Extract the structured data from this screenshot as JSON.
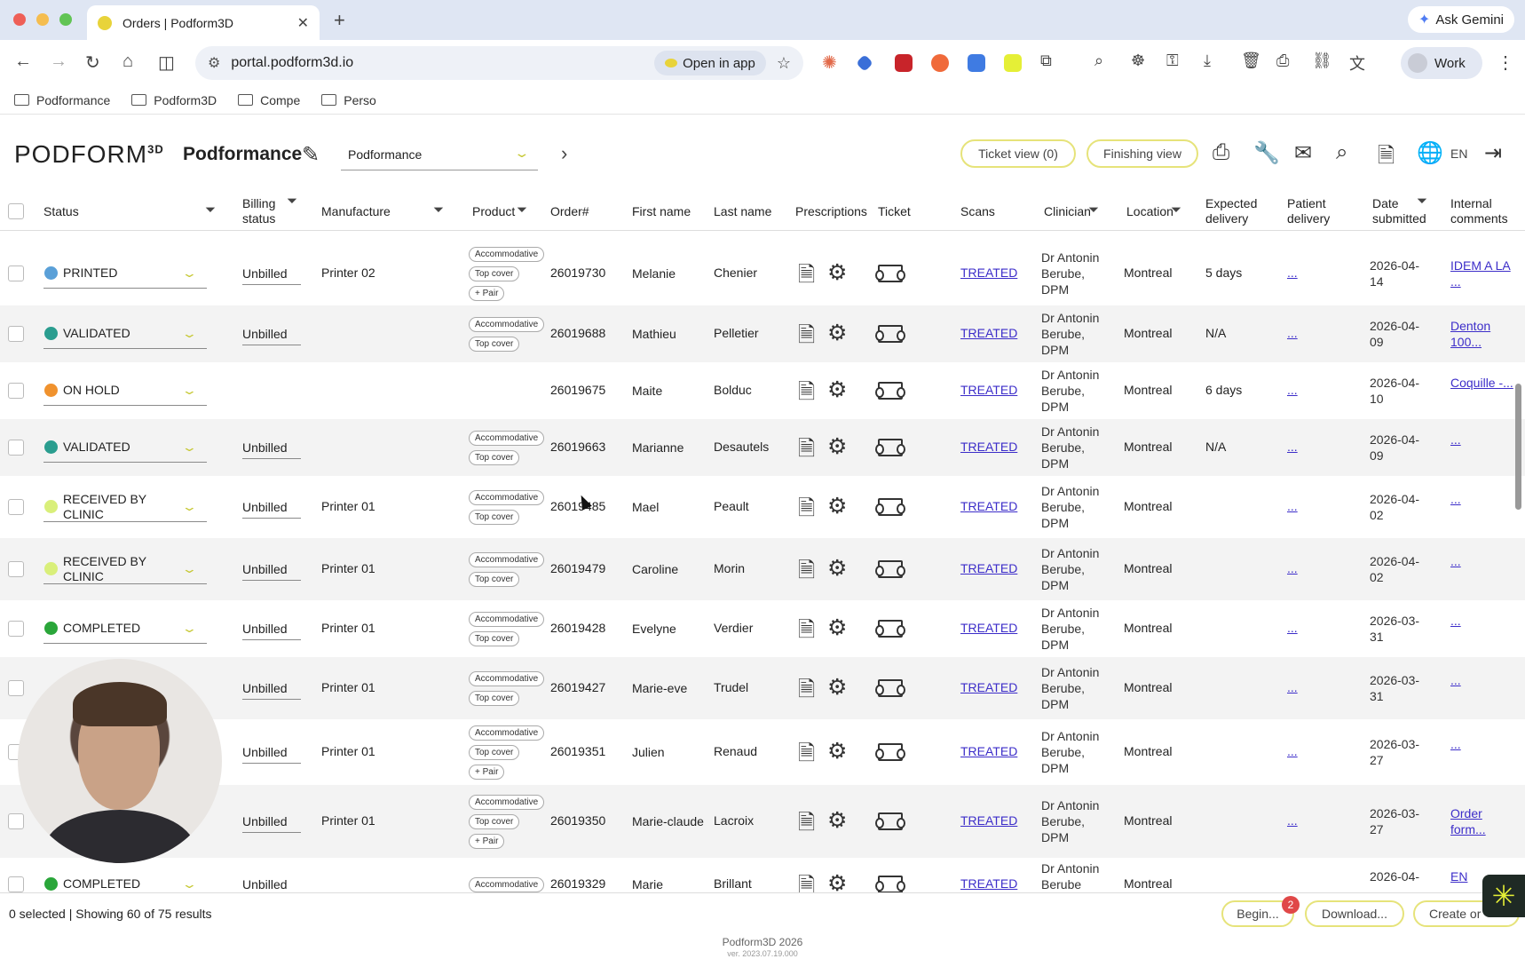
{
  "browser": {
    "tab_title": "Orders | Podform3D",
    "url": "portal.podform3d.io",
    "open_in_app": "Open in app",
    "ask_gemini": "Ask Gemini",
    "profile": "Work",
    "bookmarks": [
      "Podformance",
      "Podform3D",
      "Compe",
      "Perso"
    ],
    "colors": {
      "close": "#ee5f57",
      "minimize": "#f5bd4f",
      "maximize": "#61c454"
    }
  },
  "app": {
    "logo": "PODFORM",
    "logo_sup": "3D",
    "org_title": "Podformance",
    "org_select": "Podformance",
    "ticket_view": "Ticket view (0)",
    "finishing_view": "Finishing view",
    "lang": "EN"
  },
  "columns": {
    "status": "Status",
    "billing": "Billing status",
    "manufacture": "Manufacture",
    "product": "Product",
    "order": "Order#",
    "first": "First name",
    "last": "Last name",
    "prescriptions": "Prescriptions",
    "ticket": "Ticket",
    "scans": "Scans",
    "clinician": "Clinician",
    "location": "Location",
    "expected": "Expected delivery",
    "patient": "Patient delivery",
    "date": "Date submitted",
    "comments": "Internal comments"
  },
  "rows": [
    {
      "status": "PRINTED",
      "dot": "#5aa0d8",
      "billing": "Unbilled",
      "manufacture": "Printer 02",
      "chips": [
        "Accommodative",
        "Top cover",
        "+ Pair"
      ],
      "order": "26019730",
      "first": "Melanie",
      "last": "Chenier",
      "scans": "TREATED",
      "clinician": "Dr Antonin Berube, DPM",
      "location": "Montreal",
      "expected": "5 days",
      "patient": "...",
      "date": "2026-04-14",
      "comment": "IDEM A LA ..."
    },
    {
      "status": "VALIDATED",
      "dot": "#2a9d8f",
      "billing": "Unbilled",
      "manufacture": "",
      "chips": [
        "Accommodative",
        "Top cover"
      ],
      "order": "26019688",
      "first": "Mathieu",
      "last": "Pelletier",
      "scans": "TREATED",
      "clinician": "Dr Antonin Berube, DPM",
      "location": "Montreal",
      "expected": "N/A",
      "patient": "...",
      "date": "2026-04-09",
      "comment": "Denton 100..."
    },
    {
      "status": "ON HOLD",
      "dot": "#f0922e",
      "billing": "",
      "manufacture": "",
      "chips": [],
      "order": "26019675",
      "first": "Maite",
      "last": "Bolduc",
      "scans": "TREATED",
      "clinician": "Dr Antonin Berube, DPM",
      "location": "Montreal",
      "expected": "6 days",
      "patient": "...",
      "date": "2026-04-10",
      "comment": "Coquille -..."
    },
    {
      "status": "VALIDATED",
      "dot": "#2a9d8f",
      "billing": "Unbilled",
      "manufacture": "",
      "chips": [
        "Accommodative",
        "Top cover"
      ],
      "order": "26019663",
      "first": "Marianne",
      "last": "Desautels",
      "scans": "TREATED",
      "clinician": "Dr Antonin Berube, DPM",
      "location": "Montreal",
      "expected": "N/A",
      "patient": "...",
      "date": "2026-04-09",
      "comment": "..."
    },
    {
      "status": "RECEIVED BY CLINIC",
      "dot": "#d9ef7a",
      "billing": "Unbilled",
      "manufacture": "Printer 01",
      "chips": [
        "Accommodative",
        "Top cover"
      ],
      "order": "26019485",
      "first": "Mael",
      "last": "Peault",
      "scans": "TREATED",
      "clinician": "Dr Antonin Berube, DPM",
      "location": "Montreal",
      "expected": "",
      "patient": "...",
      "date": "2026-04-02",
      "comment": "..."
    },
    {
      "status": "RECEIVED BY CLINIC",
      "dot": "#d9ef7a",
      "billing": "Unbilled",
      "manufacture": "Printer 01",
      "chips": [
        "Accommodative",
        "Top cover"
      ],
      "order": "26019479",
      "first": "Caroline",
      "last": "Morin",
      "scans": "TREATED",
      "clinician": "Dr Antonin Berube, DPM",
      "location": "Montreal",
      "expected": "",
      "patient": "...",
      "date": "2026-04-02",
      "comment": "..."
    },
    {
      "status": "COMPLETED",
      "dot": "#2aa63a",
      "billing": "Unbilled",
      "manufacture": "Printer 01",
      "chips": [
        "Accommodative",
        "Top cover"
      ],
      "order": "26019428",
      "first": "Evelyne",
      "last": "Verdier",
      "scans": "TREATED",
      "clinician": "Dr Antonin Berube, DPM",
      "location": "Montreal",
      "expected": "",
      "patient": "...",
      "date": "2026-03-31",
      "comment": "..."
    },
    {
      "status": "",
      "dot": "",
      "billing": "Unbilled",
      "manufacture": "Printer 01",
      "chips": [
        "Accommodative",
        "Top cover"
      ],
      "order": "26019427",
      "first": "Marie-eve",
      "last": "Trudel",
      "scans": "TREATED",
      "clinician": "Dr Antonin Berube, DPM",
      "location": "Montreal",
      "expected": "",
      "patient": "...",
      "date": "2026-03-31",
      "comment": "..."
    },
    {
      "status": "",
      "dot": "",
      "billing": "Unbilled",
      "manufacture": "Printer 01",
      "chips": [
        "Accommodative",
        "Top cover",
        "+ Pair"
      ],
      "order": "26019351",
      "first": "Julien",
      "last": "Renaud",
      "scans": "TREATED",
      "clinician": "Dr Antonin Berube, DPM",
      "location": "Montreal",
      "expected": "",
      "patient": "...",
      "date": "2026-03-27",
      "comment": "..."
    },
    {
      "status": "",
      "dot": "",
      "billing": "Unbilled",
      "manufacture": "Printer 01",
      "chips": [
        "Accommodative",
        "Top cover",
        "+ Pair"
      ],
      "order": "26019350",
      "first": "Marie-claude",
      "last": "Lacroix",
      "scans": "TREATED",
      "clinician": "Dr Antonin Berube, DPM",
      "location": "Montreal",
      "expected": "",
      "patient": "...",
      "date": "2026-03-27",
      "comment": "Order form..."
    },
    {
      "status": "COMPLETED",
      "dot": "#2aa63a",
      "billing": "Unbilled",
      "manufacture": "",
      "chips": [
        "Accommodative"
      ],
      "order": "26019329",
      "first": "Marie",
      "last": "Brillant",
      "scans": "TREATED",
      "clinician": "Dr Antonin Berube",
      "location": "Montreal",
      "expected": "",
      "patient": "",
      "date": "2026-04-",
      "comment": "EN"
    }
  ],
  "footer": {
    "selection": "0 selected | Showing 60 of 75 results",
    "begin": "Begin...",
    "badge": "2",
    "download": "Download...",
    "create": "Create or",
    "copyright": "Podform3D 2026",
    "version": "ver. 2023.07.19.000"
  }
}
